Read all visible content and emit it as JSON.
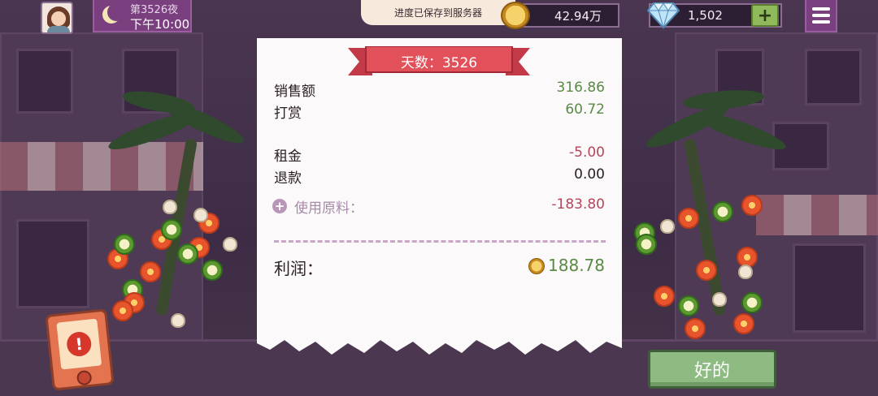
{
  "hud": {
    "night_label": "第3526夜",
    "time_label": "下午10:00",
    "coins": "42.94万",
    "gems": "1,502",
    "add_label": "+"
  },
  "toast": "进度已保存到服务器",
  "receipt": {
    "day_banner": "天数：3526",
    "rows": [
      {
        "label": "销售额",
        "value": "316.86"
      },
      {
        "label": "打赏",
        "value": "60.72"
      },
      {
        "label": "租金",
        "value": "-5.00"
      },
      {
        "label": "退款",
        "value": "0.00"
      }
    ],
    "materials_label": "使用原料：",
    "materials_value": "-183.80",
    "profit_label": "利润：",
    "profit_value": "188.78"
  },
  "ok_button": "好的",
  "colors": {
    "positive": "#5a8a45",
    "negative": "#b5455b",
    "banner": "#e2505a",
    "ok_button": "#8dbb82"
  },
  "icons": [
    "moon-icon",
    "coin-icon",
    "gem-icon",
    "plus-icon",
    "menu-icon",
    "alert-icon"
  ]
}
